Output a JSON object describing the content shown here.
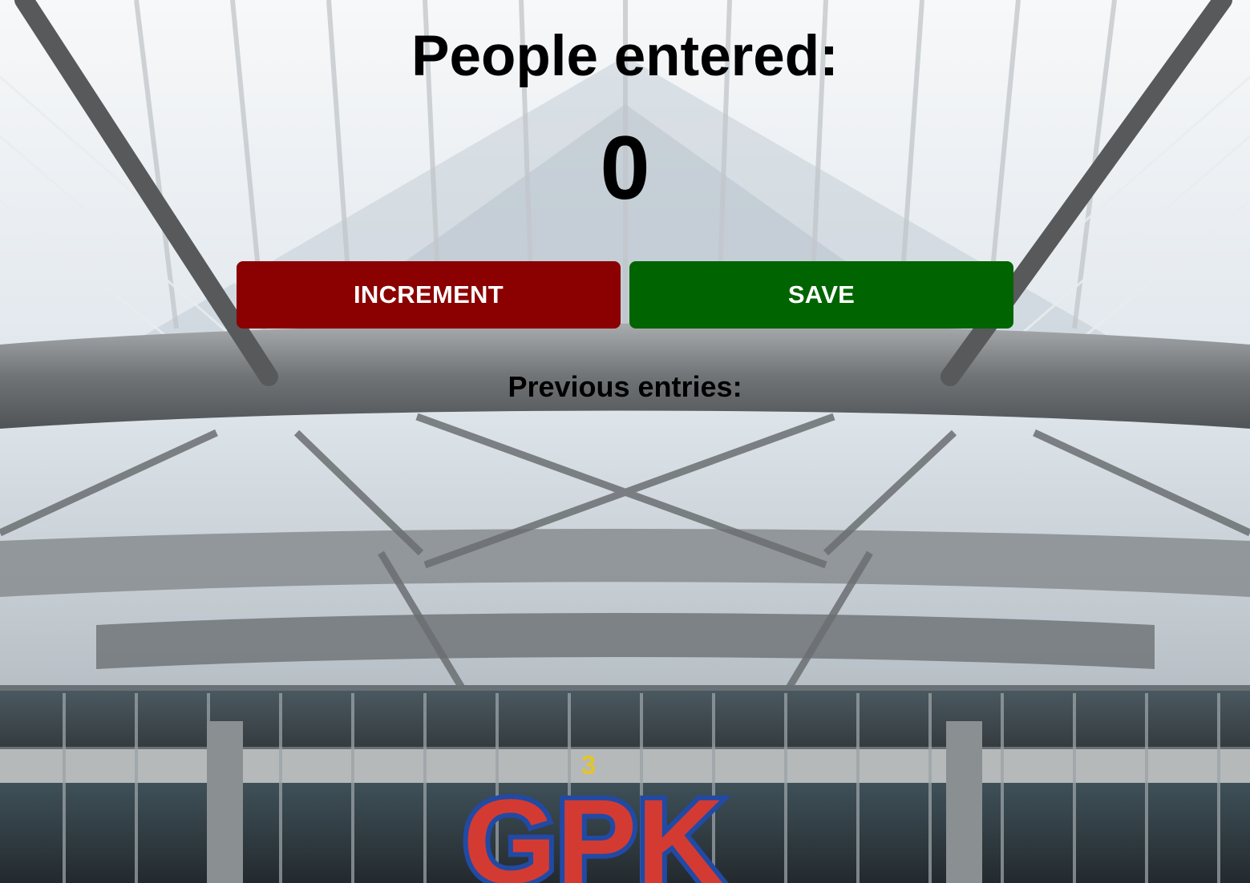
{
  "page": {
    "title": "People entered:",
    "count": "0"
  },
  "actions": {
    "increment_label": "INCREMENT",
    "save_label": "SAVE"
  },
  "entries": {
    "heading": "Previous entries:",
    "items": []
  },
  "background": {
    "subject": "airport canopy entrance",
    "sign_number": "3",
    "sign_text": "GPK"
  },
  "colors": {
    "increment": "#8b0000",
    "save": "#006400",
    "text": "#000000"
  }
}
